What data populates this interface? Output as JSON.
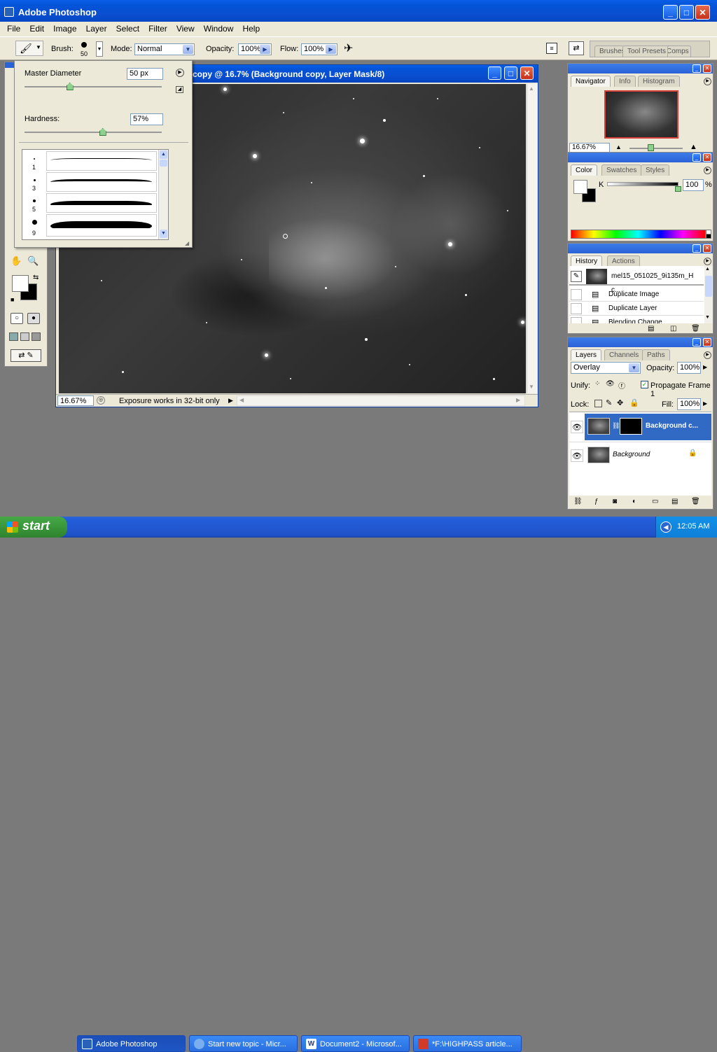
{
  "app": {
    "title": "Adobe Photoshop"
  },
  "menu": [
    "File",
    "Edit",
    "Image",
    "Layer",
    "Select",
    "Filter",
    "View",
    "Window",
    "Help"
  ],
  "options": {
    "brush_label": "Brush:",
    "brush_size": "50",
    "mode_label": "Mode:",
    "mode_value": "Normal",
    "opacity_label": "Opacity:",
    "opacity_value": "100%",
    "flow_label": "Flow:",
    "flow_value": "100%",
    "well_tabs": [
      "Brushes",
      "Tool Presets",
      "Comps"
    ]
  },
  "brush_popup": {
    "master_diameter_label": "Master Diameter",
    "master_diameter_value": "50 px",
    "master_diameter_slider": 0.33,
    "hardness_label": "Hardness:",
    "hardness_value": "57%",
    "hardness_slider": 0.57,
    "presets": [
      {
        "size": "1"
      },
      {
        "size": "3"
      },
      {
        "size": "5"
      },
      {
        "size": "9"
      }
    ]
  },
  "document": {
    "title": "copy @ 16.7% (Background copy, Layer Mask/8)",
    "zoom": "16.67%",
    "status": "Exposure works in 32-bit only"
  },
  "navigator": {
    "tabs": [
      "Navigator",
      "Info",
      "Histogram"
    ],
    "zoom": "16.67%"
  },
  "color": {
    "tabs": [
      "Color",
      "Swatches",
      "Styles"
    ],
    "channel": "K",
    "value": "100",
    "unit": "%"
  },
  "history": {
    "tabs": [
      "History",
      "Actions"
    ],
    "snapshot": "mel15_051025_9i135m_H c...",
    "items": [
      "Duplicate Image",
      "Duplicate Layer",
      "Blending Change"
    ]
  },
  "layers": {
    "tabs": [
      "Layers",
      "Channels",
      "Paths"
    ],
    "blend_mode": "Overlay",
    "opacity_label": "Opacity:",
    "opacity_value": "100%",
    "unify_label": "Unify:",
    "propagate_label": "Propagate Frame 1",
    "lock_label": "Lock:",
    "fill_label": "Fill:",
    "fill_value": "100%",
    "items": [
      {
        "name": "Background c...",
        "selected": true
      },
      {
        "name": "Background",
        "selected": false
      }
    ]
  },
  "taskbar": {
    "start": "start",
    "items": [
      "Adobe Photoshop",
      "Start new topic - Micr...",
      "Document2 - Microsof...",
      "*F:\\HIGHPASS article..."
    ],
    "clock": "12:05 AM"
  },
  "colors": {
    "xp_blue": "#0a54d8",
    "selection": "#316ac5",
    "start_green": "#3c9a3c"
  }
}
